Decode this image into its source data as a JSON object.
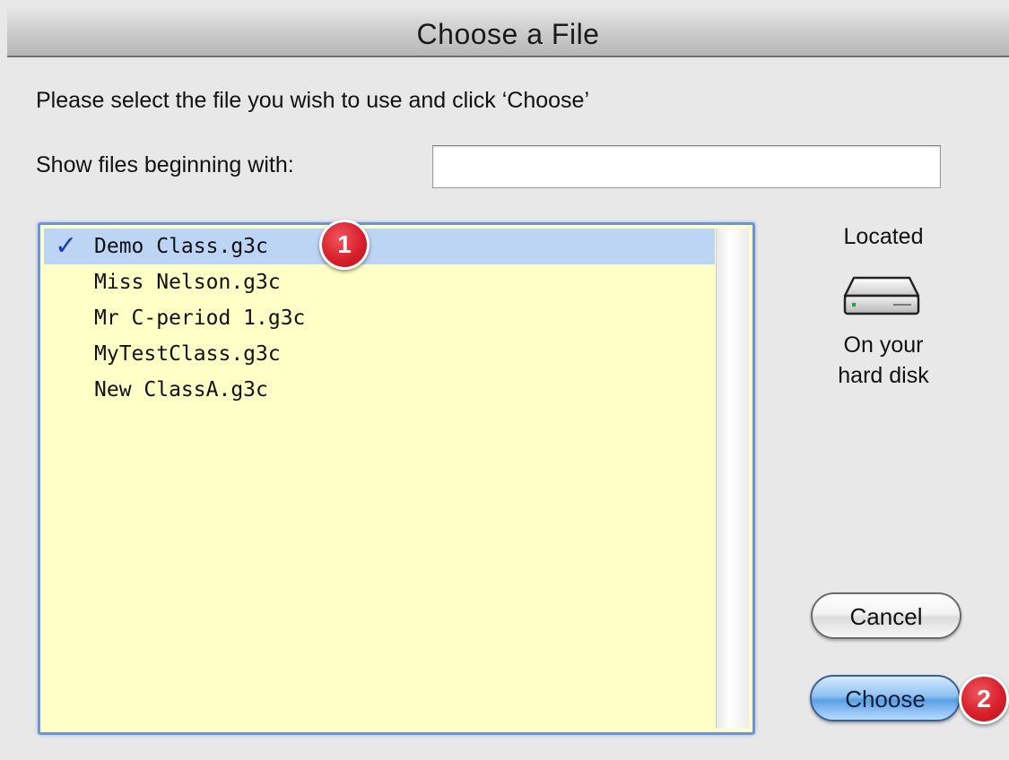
{
  "window": {
    "title": "Choose a File"
  },
  "prompt": "Please select the file you wish to use and click ‘Choose’",
  "filter": {
    "label": "Show files beginning with:",
    "value": ""
  },
  "files": [
    {
      "name": "Demo Class.g3c",
      "selected": true
    },
    {
      "name": "Miss Nelson.g3c",
      "selected": false
    },
    {
      "name": "Mr C-period 1.g3c",
      "selected": false
    },
    {
      "name": "MyTestClass.g3c",
      "selected": false
    },
    {
      "name": "New ClassA.g3c",
      "selected": false
    }
  ],
  "location": {
    "label": "Located",
    "icon": "hard-disk-icon",
    "description_line1": "On your",
    "description_line2": "hard disk"
  },
  "buttons": {
    "cancel": "Cancel",
    "choose": "Choose"
  },
  "annotations": {
    "step1": "1",
    "step2": "2"
  },
  "colors": {
    "list_background": "#ffffc8",
    "selection": "#bdd5f5",
    "focus_ring": "#6c95d2",
    "badge": "#d8202b",
    "default_button": "#5b9fe4"
  }
}
